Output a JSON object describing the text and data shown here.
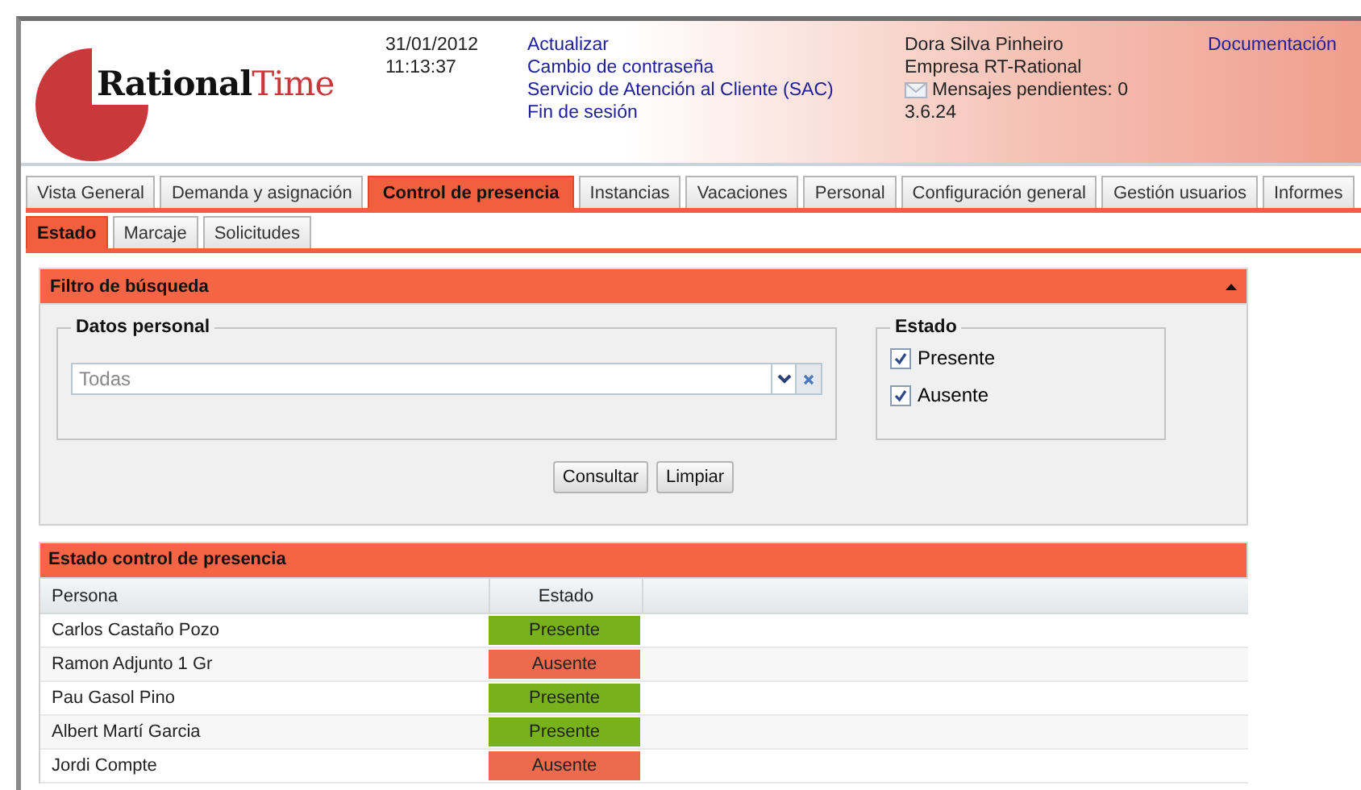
{
  "header": {
    "logo": "**Rational**Time",
    "date": "31/01/2012",
    "time": "11:13:37",
    "links": [
      "Actualizar",
      "Cambio de contraseña",
      "Servicio de Atención al Cliente (SAC)",
      "Fin de sesión"
    ],
    "user": "Dora Silva Pinheiro",
    "company": "Empresa RT-Rational",
    "messages": "Mensajes pendientes: 0",
    "version": "3.6.24",
    "docs_link": "Documentación"
  },
  "tabs": [
    {
      "label": "Vista General",
      "selected": false
    },
    {
      "label": "Demanda y asignación",
      "selected": false
    },
    {
      "label": "Control de presencia",
      "selected": true
    },
    {
      "label": "Instancias",
      "selected": false
    },
    {
      "label": "Vacaciones",
      "selected": false
    },
    {
      "label": "Personal",
      "selected": false
    },
    {
      "label": "Configuración general",
      "selected": false
    },
    {
      "label": "Gestión usuarios",
      "selected": false
    },
    {
      "label": "Informes",
      "selected": false
    }
  ],
  "subtabs": [
    {
      "label": "Estado",
      "selected": true
    },
    {
      "label": "Marcaje",
      "selected": false
    },
    {
      "label": "Solicitudes",
      "selected": false
    }
  ],
  "filter": {
    "title": "Filtro de búsqueda",
    "expanded": true,
    "personal": {
      "legend": "Datos personal",
      "placeholder": "Todas"
    },
    "estado": {
      "legend": "Estado",
      "options": [
        {
          "label": "Presente",
          "checked": true
        },
        {
          "label": "Ausente",
          "checked": true
        }
      ]
    },
    "buttons": [
      "Consultar",
      "Limpiar"
    ]
  },
  "results": {
    "title": "Estado control de presencia",
    "columns": [
      "Persona",
      "Estado"
    ],
    "rows": [
      {
        "persona": "Carlos Castaño Pozo",
        "estado": "Presente",
        "color": "#77b21c"
      },
      {
        "persona": "Ramon Adjunto 1 Gr",
        "estado": "Ausente",
        "color": "#ec6a4e"
      },
      {
        "persona": "Pau Gasol Pino",
        "estado": "Presente",
        "color": "#77b21c"
      },
      {
        "persona": "Albert Martí Garcia",
        "estado": "Presente",
        "color": "#77b21c"
      },
      {
        "persona": "Jordi Compte",
        "estado": "Ausente",
        "color": "#ec6a4e"
      }
    ]
  }
}
